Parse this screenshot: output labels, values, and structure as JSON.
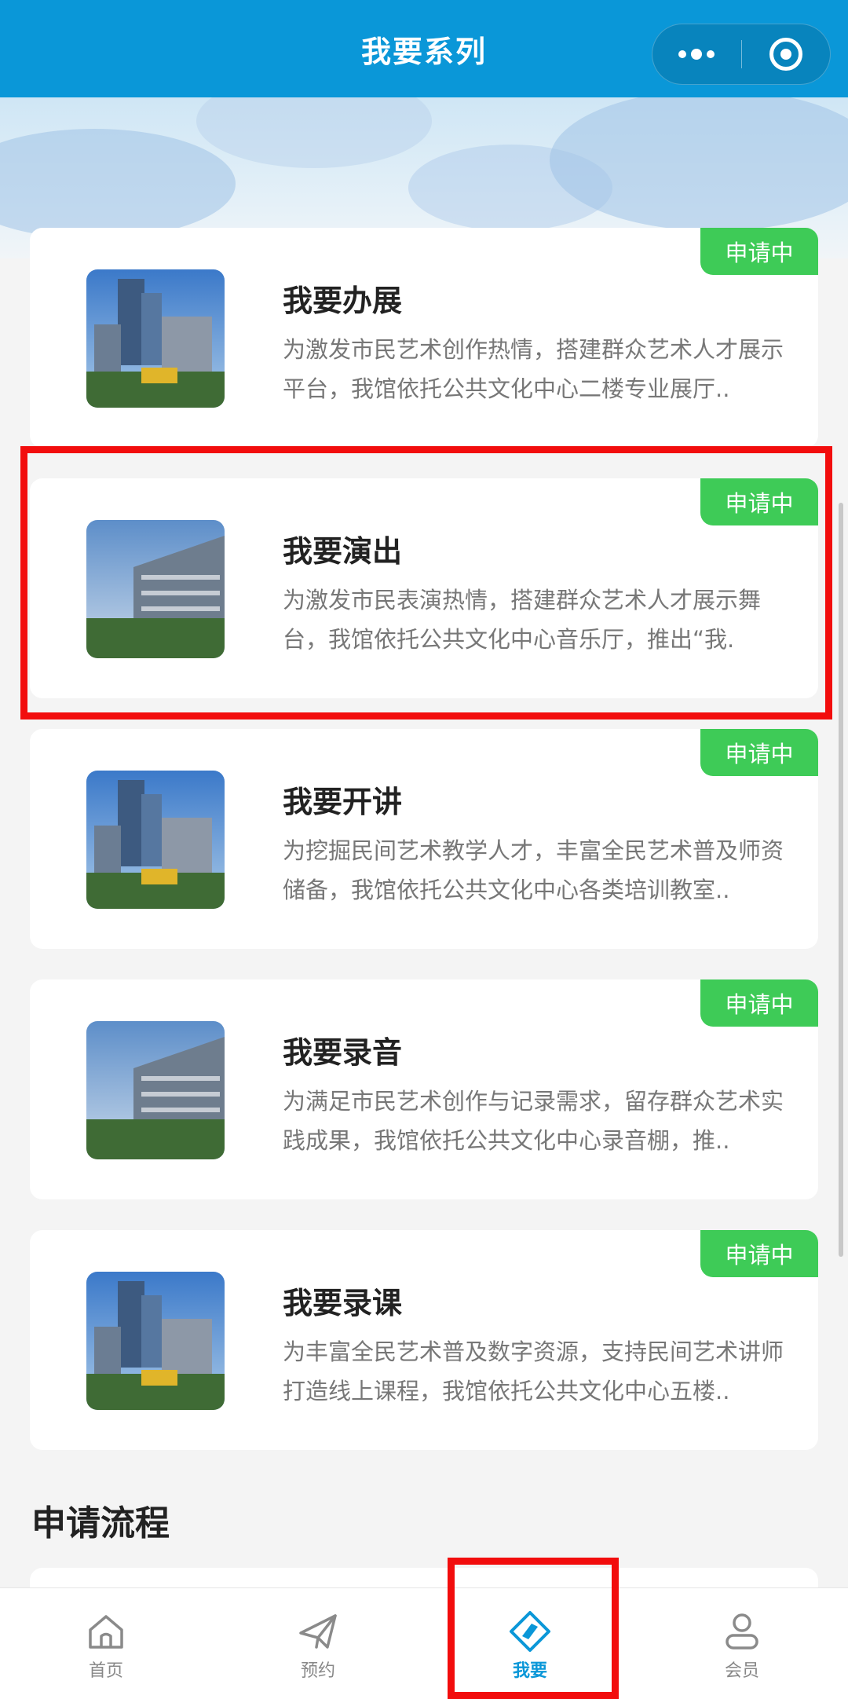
{
  "header": {
    "title": "我要系列",
    "menu_icon": "more-dots-icon",
    "close_icon": "target-circle-icon"
  },
  "cards": [
    {
      "title": "我要办展",
      "desc": "为激发市民艺术创作热情，搭建群众艺术人才展示平台，我馆依托公共文化中心二楼专业展厅..",
      "badge": "申请中"
    },
    {
      "title": "我要演出",
      "desc": "为激发市民表演热情，搭建群众艺术人才展示舞台，我馆依托公共文化中心音乐厅，推出“我.",
      "badge": "申请中"
    },
    {
      "title": "我要开讲",
      "desc": "为挖掘民间艺术教学人才，丰富全民艺术普及师资储备，我馆依托公共文化中心各类培训教室..",
      "badge": "申请中"
    },
    {
      "title": "我要录音",
      "desc": "为满足市民艺术创作与记录需求，留存群众艺术实践成果，我馆依托公共文化中心录音棚，推..",
      "badge": "申请中"
    },
    {
      "title": "我要录课",
      "desc": "为丰富全民艺术普及数字资源，支持民间艺术讲师打造线上课程，我馆依托公共文化中心五楼..",
      "badge": "申请中"
    }
  ],
  "section": {
    "title": "申请流程"
  },
  "tabbar": {
    "items": [
      {
        "label": "首页",
        "icon": "home-icon",
        "active": false
      },
      {
        "label": "预约",
        "icon": "paper-plane-icon",
        "active": false
      },
      {
        "label": "我要",
        "icon": "diamond-compass-icon",
        "active": true
      },
      {
        "label": "会员",
        "icon": "user-icon",
        "active": false
      }
    ]
  },
  "colors": {
    "primary": "#0a97d8",
    "badge": "#3ecb57",
    "highlight": "#f20d0d"
  }
}
